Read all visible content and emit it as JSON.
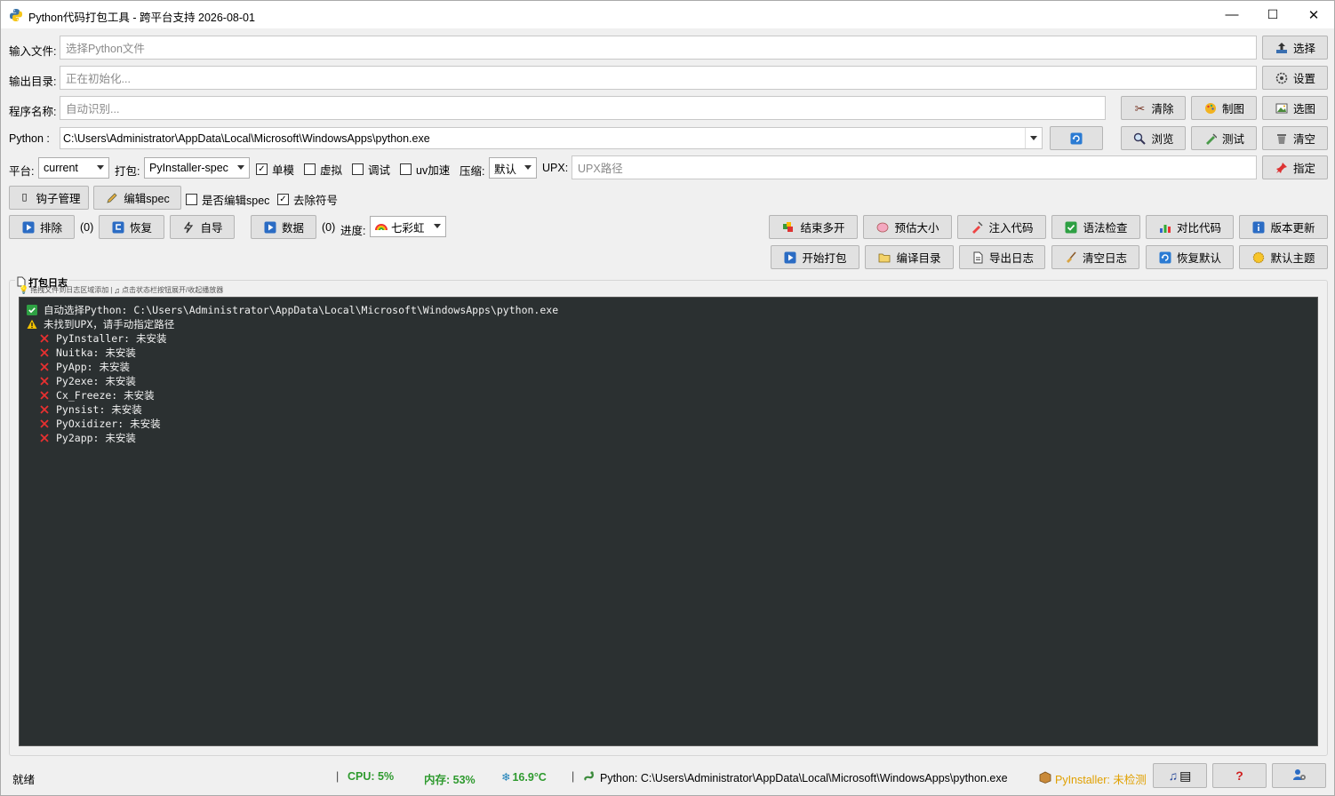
{
  "window": {
    "title": "Python代码打包工具 - 跨平台支持 2026-08-01",
    "minimize": "—",
    "maximize": "☐",
    "close": "✕"
  },
  "input_file": {
    "label": "输入文件:",
    "placeholder": "选择Python文件",
    "button": "选择"
  },
  "output_dir": {
    "label": "输出目录:",
    "placeholder": "正在初始化...",
    "button": "设置"
  },
  "program_name": {
    "label": "程序名称:",
    "placeholder": "自动识别...",
    "buttons": {
      "clear": "清除",
      "draw": "制图",
      "pick_image": "选图"
    }
  },
  "python": {
    "label": "Python  :",
    "value": "C:\\Users\\Administrator\\AppData\\Local\\Microsoft\\WindowsApps\\python.exe",
    "buttons": {
      "browse": "浏览",
      "test": "测试",
      "empty": "清空"
    }
  },
  "options": {
    "platform_label": "平台:",
    "platform_value": "current",
    "pack_label": "打包:",
    "pack_value": "PyInstaller-spec",
    "single": {
      "label": "单模",
      "checked": true
    },
    "virtual": {
      "label": "虚拟",
      "checked": false
    },
    "debug": {
      "label": "调试",
      "checked": false
    },
    "uv": {
      "label": "uv加速",
      "checked": false
    },
    "compress_label": "压缩:",
    "compress_value": "默认",
    "upx_label": "UPX:",
    "upx_placeholder": "UPX路径",
    "assign_button": "指定"
  },
  "row6": {
    "hook_button": "钩子管理",
    "edit_spec_button": "编辑spec",
    "edit_spec_check": {
      "label": "是否编辑spec",
      "checked": false
    },
    "strip_check": {
      "label": "去除符号",
      "checked": true
    }
  },
  "row7": {
    "exclude_button": "排除",
    "exclude_count": "(0)",
    "restore_button": "恢复",
    "auto_import_button": "自导",
    "data_button": "数据",
    "data_count": "(0)",
    "progress_label": "进度:",
    "progress_style": "七彩虹",
    "end_multi_button": "结束多开",
    "estimate_button": "预估大小",
    "inject_button": "注入代码",
    "syntax_button": "语法检查",
    "compare_button": "对比代码",
    "update_button": "版本更新"
  },
  "row8": {
    "start_button": "开始打包",
    "compile_dir_button": "编译目录",
    "export_log_button": "导出日志",
    "clear_log_button": "清空日志",
    "restore_default_button": "恢复默认",
    "default_theme_button": "默认主题"
  },
  "log": {
    "group_title": "打包日志",
    "hint_drag": "拖拽文件到日志区域添加",
    "hint_player": "点击状态栏按钮展开/收起播放器",
    "lines": [
      {
        "icon": "check",
        "text": "自动选择Python: C:\\Users\\Administrator\\AppData\\Local\\Microsoft\\WindowsApps\\python.exe",
        "indent": false
      },
      {
        "icon": "warning",
        "text": "未找到UPX，请手动指定路径",
        "indent": false
      },
      {
        "icon": "cross",
        "text": "PyInstaller: 未安装",
        "indent": true
      },
      {
        "icon": "cross",
        "text": "Nuitka: 未安装",
        "indent": true
      },
      {
        "icon": "cross",
        "text": "PyApp: 未安装",
        "indent": true
      },
      {
        "icon": "cross",
        "text": "Py2exe: 未安装",
        "indent": true
      },
      {
        "icon": "cross",
        "text": "Cx_Freeze: 未安装",
        "indent": true
      },
      {
        "icon": "cross",
        "text": "Pynsist: 未安装",
        "indent": true
      },
      {
        "icon": "cross",
        "text": "PyOxidizer: 未安装",
        "indent": true
      },
      {
        "icon": "cross",
        "text": "Py2app: 未安装",
        "indent": true
      }
    ]
  },
  "status": {
    "ready": "就绪",
    "cpu": "CPU: 5%",
    "memory": "内存: 53%",
    "temperature": "16.9°C",
    "python_path": "Python: C:\\Users\\Administrator\\AppData\\Local\\Microsoft\\WindowsApps\\python.exe",
    "pyinstaller": "PyInstaller: 未检测",
    "colors": {
      "green": "#2e9a2e",
      "orange": "#e0a000"
    }
  }
}
